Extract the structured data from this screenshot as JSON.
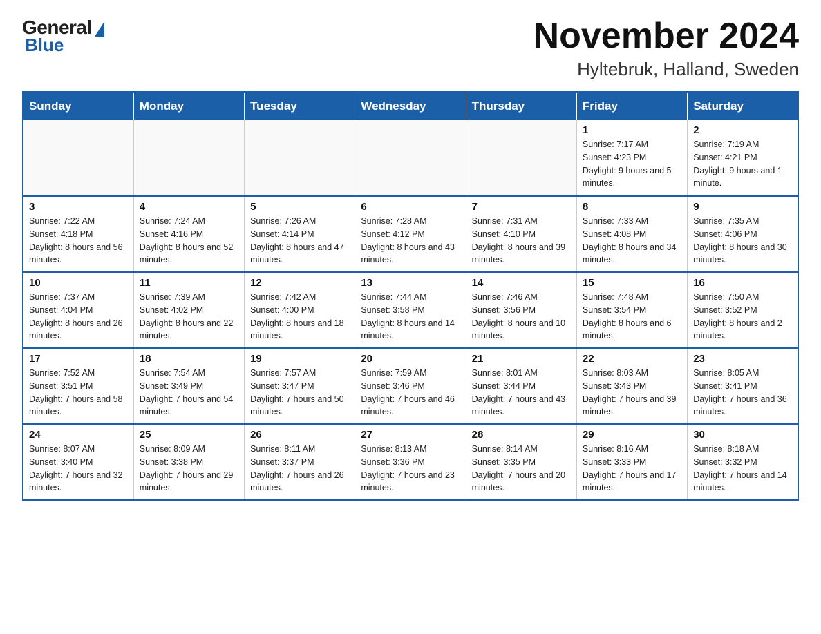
{
  "logo": {
    "general": "General",
    "blue": "Blue"
  },
  "header": {
    "month_year": "November 2024",
    "location": "Hyltebruk, Halland, Sweden"
  },
  "weekdays": [
    "Sunday",
    "Monday",
    "Tuesday",
    "Wednesday",
    "Thursday",
    "Friday",
    "Saturday"
  ],
  "weeks": [
    [
      {
        "day": "",
        "info": ""
      },
      {
        "day": "",
        "info": ""
      },
      {
        "day": "",
        "info": ""
      },
      {
        "day": "",
        "info": ""
      },
      {
        "day": "",
        "info": ""
      },
      {
        "day": "1",
        "info": "Sunrise: 7:17 AM\nSunset: 4:23 PM\nDaylight: 9 hours and 5 minutes."
      },
      {
        "day": "2",
        "info": "Sunrise: 7:19 AM\nSunset: 4:21 PM\nDaylight: 9 hours and 1 minute."
      }
    ],
    [
      {
        "day": "3",
        "info": "Sunrise: 7:22 AM\nSunset: 4:18 PM\nDaylight: 8 hours and 56 minutes."
      },
      {
        "day": "4",
        "info": "Sunrise: 7:24 AM\nSunset: 4:16 PM\nDaylight: 8 hours and 52 minutes."
      },
      {
        "day": "5",
        "info": "Sunrise: 7:26 AM\nSunset: 4:14 PM\nDaylight: 8 hours and 47 minutes."
      },
      {
        "day": "6",
        "info": "Sunrise: 7:28 AM\nSunset: 4:12 PM\nDaylight: 8 hours and 43 minutes."
      },
      {
        "day": "7",
        "info": "Sunrise: 7:31 AM\nSunset: 4:10 PM\nDaylight: 8 hours and 39 minutes."
      },
      {
        "day": "8",
        "info": "Sunrise: 7:33 AM\nSunset: 4:08 PM\nDaylight: 8 hours and 34 minutes."
      },
      {
        "day": "9",
        "info": "Sunrise: 7:35 AM\nSunset: 4:06 PM\nDaylight: 8 hours and 30 minutes."
      }
    ],
    [
      {
        "day": "10",
        "info": "Sunrise: 7:37 AM\nSunset: 4:04 PM\nDaylight: 8 hours and 26 minutes."
      },
      {
        "day": "11",
        "info": "Sunrise: 7:39 AM\nSunset: 4:02 PM\nDaylight: 8 hours and 22 minutes."
      },
      {
        "day": "12",
        "info": "Sunrise: 7:42 AM\nSunset: 4:00 PM\nDaylight: 8 hours and 18 minutes."
      },
      {
        "day": "13",
        "info": "Sunrise: 7:44 AM\nSunset: 3:58 PM\nDaylight: 8 hours and 14 minutes."
      },
      {
        "day": "14",
        "info": "Sunrise: 7:46 AM\nSunset: 3:56 PM\nDaylight: 8 hours and 10 minutes."
      },
      {
        "day": "15",
        "info": "Sunrise: 7:48 AM\nSunset: 3:54 PM\nDaylight: 8 hours and 6 minutes."
      },
      {
        "day": "16",
        "info": "Sunrise: 7:50 AM\nSunset: 3:52 PM\nDaylight: 8 hours and 2 minutes."
      }
    ],
    [
      {
        "day": "17",
        "info": "Sunrise: 7:52 AM\nSunset: 3:51 PM\nDaylight: 7 hours and 58 minutes."
      },
      {
        "day": "18",
        "info": "Sunrise: 7:54 AM\nSunset: 3:49 PM\nDaylight: 7 hours and 54 minutes."
      },
      {
        "day": "19",
        "info": "Sunrise: 7:57 AM\nSunset: 3:47 PM\nDaylight: 7 hours and 50 minutes."
      },
      {
        "day": "20",
        "info": "Sunrise: 7:59 AM\nSunset: 3:46 PM\nDaylight: 7 hours and 46 minutes."
      },
      {
        "day": "21",
        "info": "Sunrise: 8:01 AM\nSunset: 3:44 PM\nDaylight: 7 hours and 43 minutes."
      },
      {
        "day": "22",
        "info": "Sunrise: 8:03 AM\nSunset: 3:43 PM\nDaylight: 7 hours and 39 minutes."
      },
      {
        "day": "23",
        "info": "Sunrise: 8:05 AM\nSunset: 3:41 PM\nDaylight: 7 hours and 36 minutes."
      }
    ],
    [
      {
        "day": "24",
        "info": "Sunrise: 8:07 AM\nSunset: 3:40 PM\nDaylight: 7 hours and 32 minutes."
      },
      {
        "day": "25",
        "info": "Sunrise: 8:09 AM\nSunset: 3:38 PM\nDaylight: 7 hours and 29 minutes."
      },
      {
        "day": "26",
        "info": "Sunrise: 8:11 AM\nSunset: 3:37 PM\nDaylight: 7 hours and 26 minutes."
      },
      {
        "day": "27",
        "info": "Sunrise: 8:13 AM\nSunset: 3:36 PM\nDaylight: 7 hours and 23 minutes."
      },
      {
        "day": "28",
        "info": "Sunrise: 8:14 AM\nSunset: 3:35 PM\nDaylight: 7 hours and 20 minutes."
      },
      {
        "day": "29",
        "info": "Sunrise: 8:16 AM\nSunset: 3:33 PM\nDaylight: 7 hours and 17 minutes."
      },
      {
        "day": "30",
        "info": "Sunrise: 8:18 AM\nSunset: 3:32 PM\nDaylight: 7 hours and 14 minutes."
      }
    ]
  ]
}
